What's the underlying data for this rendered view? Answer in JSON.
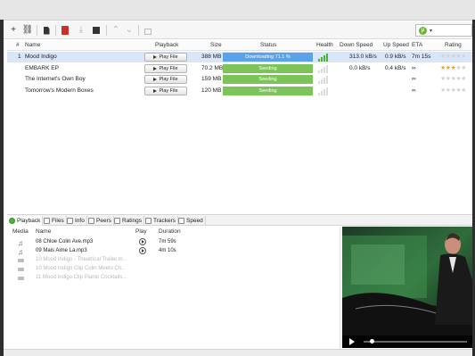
{
  "toolbar": {
    "buttons": [
      "add-torrent",
      "add-link",
      "create-torrent",
      "remove",
      "start",
      "stop",
      "move-up",
      "move-down",
      "unlock"
    ],
    "add_glyph": "+",
    "link_glyph": "⛓",
    "up_glyph": "⌃",
    "down_glyph": "⌄",
    "download_glyph": "⤓",
    "search_logo": "µ",
    "search_caret": "▾"
  },
  "torrent_table": {
    "columns": [
      "#",
      "Name",
      "Playback",
      "Size",
      "Status",
      "Health",
      "Down Speed",
      "Up Speed",
      "ETA",
      "Rating"
    ],
    "rows": [
      {
        "index": "1",
        "name": "Mood Indigo",
        "playback": "Play File",
        "size": "388 MB",
        "status": "Downloading 71.1 %",
        "status_type": "dl",
        "health": 4,
        "down": "313.0 kB/s",
        "up": "0.9 kB/s",
        "eta": "7m 15s",
        "rating": 0
      },
      {
        "index": "",
        "name": "EMBARK EP",
        "playback": "Play File",
        "size": "70.2 MB",
        "status": "Seeding",
        "status_type": "seed",
        "health": 0,
        "down": "0.0 kB/s",
        "up": "0.4 kB/s",
        "eta": "∞",
        "rating": 3
      },
      {
        "index": "",
        "name": "The Internet's Own Boy",
        "playback": "Play File",
        "size": "159 MB",
        "status": "Seeding",
        "status_type": "seed",
        "health": 0,
        "down": "",
        "up": "",
        "eta": "∞",
        "rating": 0
      },
      {
        "index": "",
        "name": "Tomorrow's Modern Boxes",
        "playback": "Play File",
        "size": "120 MB",
        "status": "Seeding",
        "status_type": "seed",
        "health": 0,
        "down": "",
        "up": "",
        "eta": "∞",
        "rating": 0
      }
    ]
  },
  "panel_tabs": [
    "Playback",
    "Files",
    "Info",
    "Peers",
    "Ratings",
    "Trackers",
    "Speed"
  ],
  "playback_list": {
    "columns": [
      "Media",
      "Name",
      "Play",
      "Duration"
    ],
    "items": [
      {
        "kind": "audio",
        "name": "08 Chloe Colin Ave.mp3",
        "duration": "7m 59s",
        "enabled": true
      },
      {
        "kind": "audio",
        "name": "09 Mais Aime La.mp3",
        "duration": "4m 10s",
        "enabled": true
      },
      {
        "kind": "video",
        "name": "10 Mood Indigo - Theatrical Trailer.m...",
        "duration": "",
        "enabled": false
      },
      {
        "kind": "video",
        "name": "10 Mood Indigo Clip Colin Meets Ch...",
        "duration": "",
        "enabled": false
      },
      {
        "kind": "video",
        "name": "11 Mood Indigo Clip Pianio Cocktails...",
        "duration": "",
        "enabled": false
      }
    ],
    "audio_glyph": "♫"
  },
  "video_player": {
    "progress": 0.08
  },
  "colors": {
    "downloading": "#5aa3e8",
    "seeding": "#7cc35a",
    "health_good": "#4caf3f",
    "star": "#f0a030"
  }
}
